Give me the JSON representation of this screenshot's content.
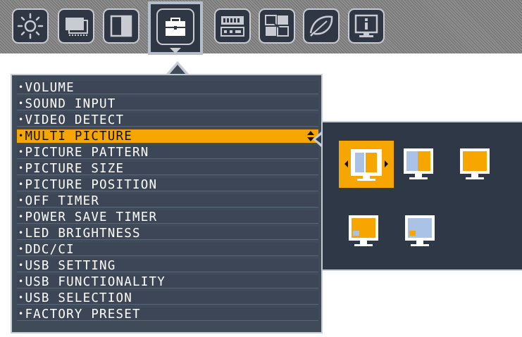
{
  "tabs": [
    {
      "name": "brightness-icon"
    },
    {
      "name": "picture-adjust-icon"
    },
    {
      "name": "color-icon"
    },
    {
      "name": "toolbox-icon",
      "active": true
    },
    {
      "name": "menu-tools-icon"
    },
    {
      "name": "eco-icon"
    },
    {
      "name": "leaf-icon"
    },
    {
      "name": "information-icon"
    }
  ],
  "menu": {
    "items": [
      {
        "label": "VOLUME"
      },
      {
        "label": "SOUND INPUT"
      },
      {
        "label": "VIDEO DETECT"
      },
      {
        "label": "MULTI PICTURE",
        "selected": true
      },
      {
        "label": "PICTURE PATTERN"
      },
      {
        "label": "PICTURE SIZE"
      },
      {
        "label": "PICTURE POSITION"
      },
      {
        "label": "OFF TIMER"
      },
      {
        "label": "POWER SAVE TIMER"
      },
      {
        "label": "LED BRIGHTNESS"
      },
      {
        "label": "DDC/CI"
      },
      {
        "label": "USB SETTING"
      },
      {
        "label": "USB FUNCTIONALITY"
      },
      {
        "label": "USB SELECTION"
      },
      {
        "label": "FACTORY PRESET"
      }
    ],
    "bullet": "•"
  },
  "submenu": {
    "options": [
      {
        "name": "multi-picture-side-by-side-option",
        "selected": true
      },
      {
        "name": "multi-picture-split-option"
      },
      {
        "name": "multi-picture-single-option"
      },
      {
        "name": "multi-picture-pip-left-option"
      },
      {
        "name": "multi-picture-pip-right-option"
      }
    ]
  },
  "colors": {
    "accent": "#f7a600",
    "panel": "#404b5a",
    "panel_dark": "#2f3847",
    "border": "#c4ccd6",
    "screen_blue": "#a9c2e6"
  }
}
